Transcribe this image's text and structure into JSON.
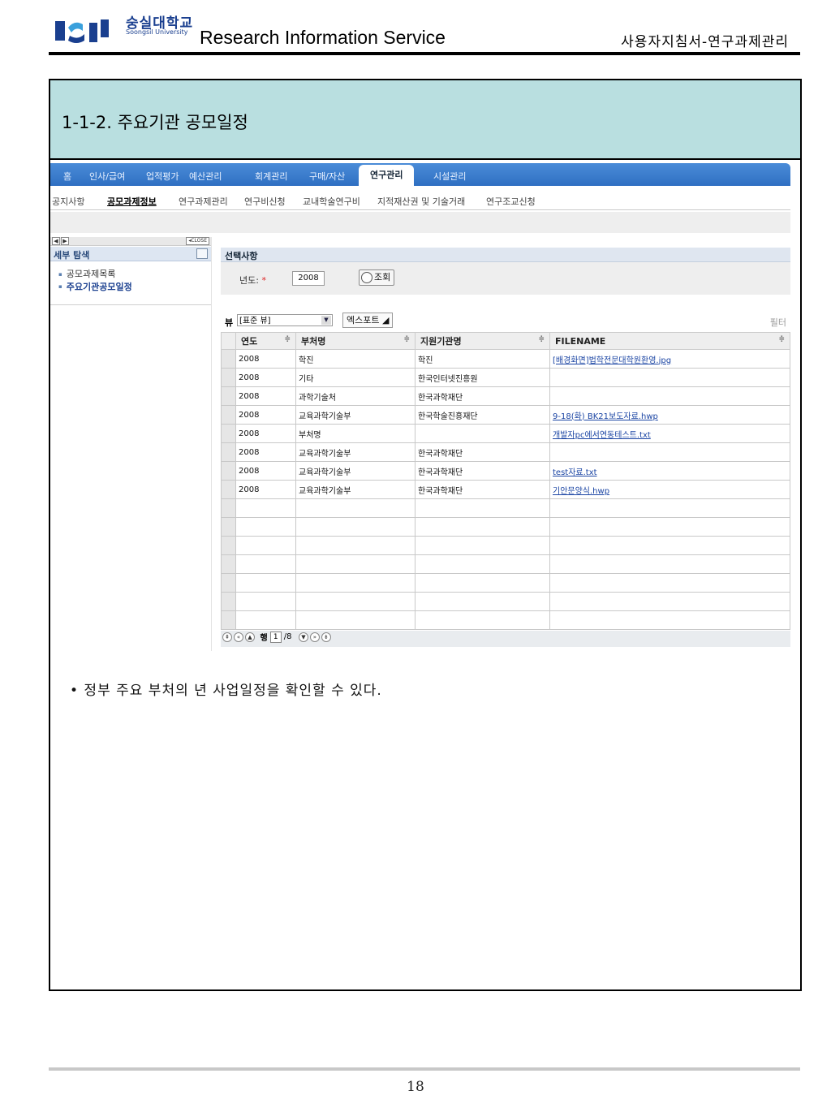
{
  "header": {
    "university_ko": "숭실대학교",
    "university_en": "Soongsil University",
    "service": "Research Information Service",
    "doc_title": "사용자지침서-연구과제관리"
  },
  "section": {
    "title": "1-1-2. 주요기관 공모일정"
  },
  "app": {
    "top_nav": [
      "홈",
      "인사/급여",
      "업적평가",
      "예산관리",
      "회계관리",
      "구매/자산",
      "연구관리",
      "시설관리"
    ],
    "top_nav_active": "연구관리",
    "sub_nav": [
      "공지사항",
      "공모과제정보",
      "연구과제관리",
      "연구비신청",
      "교내학술연구비",
      "지적재산권 및 기술거래",
      "연구조교신청"
    ],
    "sub_nav_active": "공모과제정보",
    "sidebar": {
      "close_label": "◂CLOSE",
      "title": "세부 탐색",
      "items": [
        "공모과제목록",
        "주요기관공모일정"
      ],
      "active": "주요기관공모일정"
    },
    "selection": {
      "title": "선택사항",
      "year_label": "년도:",
      "required_mark": "*",
      "year_value": "2008",
      "search_label": "조회"
    },
    "view": {
      "label": "뷰",
      "selected": "[표준 뷰]",
      "export_label": "엑스포트",
      "filter_label": "필터"
    },
    "table": {
      "columns": [
        "연도",
        "부처명",
        "지원기관명",
        "FILENAME"
      ],
      "rows": [
        [
          "2008",
          "학진",
          "학진",
          "[배경화면]법학전문대학원환영.jpg"
        ],
        [
          "2008",
          "기타",
          "한국인터넷진흥원",
          ""
        ],
        [
          "2008",
          "과학기술처",
          "한국과학재단",
          ""
        ],
        [
          "2008",
          "교육과학기술부",
          "한국학술진흥재단",
          "9-18(화) BK21보도자료.hwp"
        ],
        [
          "2008",
          "부처명",
          "",
          "개발자pc에서연동테스트.txt"
        ],
        [
          "2008",
          "교육과학기술부",
          "한국과학재단",
          ""
        ],
        [
          "2008",
          "교육과학기술부",
          "한국과학재단",
          "test자료.txt"
        ],
        [
          "2008",
          "교육과학기술부",
          "한국과학재단",
          "기안문양식.hwp"
        ]
      ],
      "empty_rows": 7
    },
    "pager": {
      "row_label": "행",
      "current": "1",
      "total": "/8"
    }
  },
  "body_text": "• 정부 주요 부처의 년 사업일정을 확인할 수 있다.",
  "footer": {
    "page_number": "18"
  },
  "colors": {
    "brand_blue": "#1a3f8f",
    "section_bg": "#b9dfe0",
    "nav_blue": "#2f6fc2"
  }
}
